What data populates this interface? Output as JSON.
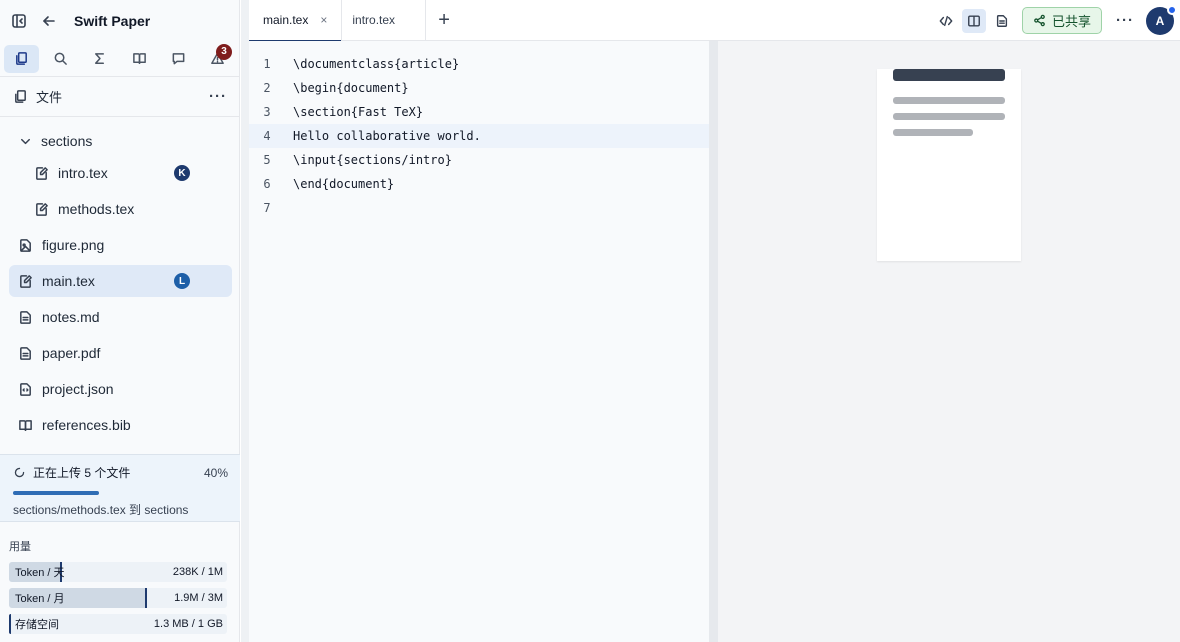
{
  "app": {
    "title": "Swift Paper"
  },
  "sidebar": {
    "tools": [
      "files-icon",
      "search-icon",
      "sigma-icon",
      "book-icon",
      "chat-icon",
      "warning-icon"
    ],
    "warning_count": "3",
    "files_label": "文件",
    "tree": [
      {
        "name": "sections",
        "kind": "folder",
        "depth": 0,
        "expanded": true
      },
      {
        "name": "intro.tex",
        "kind": "tex",
        "depth": 1,
        "avatar": "K"
      },
      {
        "name": "methods.tex",
        "kind": "tex",
        "depth": 1
      },
      {
        "name": "figure.png",
        "kind": "image",
        "depth": 0
      },
      {
        "name": "main.tex",
        "kind": "tex",
        "depth": 0,
        "avatar": "L",
        "selected": true
      },
      {
        "name": "notes.md",
        "kind": "doc",
        "depth": 0
      },
      {
        "name": "paper.pdf",
        "kind": "doc",
        "depth": 0
      },
      {
        "name": "project.json",
        "kind": "json",
        "depth": 0
      },
      {
        "name": "references.bib",
        "kind": "book",
        "depth": 0
      }
    ],
    "upload": {
      "status": "正在上传 5 个文件",
      "percent_label": "40%",
      "percent": 40,
      "detail": "sections/methods.tex 到 sections"
    },
    "usage": {
      "title": "用量",
      "meters": [
        {
          "label": "Token / 天",
          "value": "238K / 1M",
          "fraction": 0.238
        },
        {
          "label": "Token / 月",
          "value": "1.9M / 3M",
          "fraction": 0.633
        },
        {
          "label": "存储空间",
          "value": "1.3 MB / 1 GB",
          "fraction": 0.0013
        }
      ]
    }
  },
  "tabs": [
    {
      "label": "main.tex",
      "active": true,
      "closable": true,
      "close_glyph": "×"
    },
    {
      "label": "intro.tex",
      "active": false
    }
  ],
  "toolbar": {
    "add_tab_glyph": "+",
    "share_label": "已共享",
    "user_initial": "A",
    "more_glyph": "···"
  },
  "editor": {
    "current_line": 4,
    "lines": [
      "\\documentclass{article}",
      "\\begin{document}",
      "\\section{Fast TeX}",
      "Hello collaborative world.",
      "\\input{sections/intro}",
      "\\end{document}",
      ""
    ]
  },
  "colors": {
    "accent": "#1e3a6e",
    "share_bg": "#e7f6e9",
    "badge": "#7f1d1d"
  }
}
